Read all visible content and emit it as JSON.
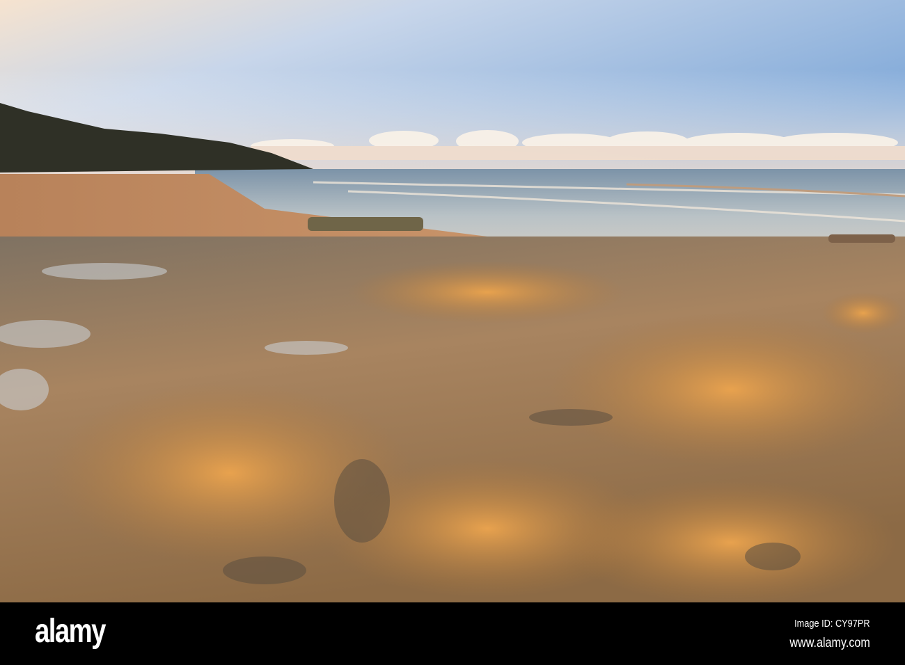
{
  "watermark": {
    "logo": "alamy",
    "image_id": "Image ID: CY97PR",
    "url": "www.alamy.com"
  },
  "colors": {
    "sky_top": "#8fb4de",
    "sky_warm": "#f3dcc6",
    "sea": "#8fa3b4",
    "sand": "#c48a5a",
    "rock_lit": "#d99a4a",
    "rock_shadow": "#6e6150",
    "headland": "#2f3026"
  }
}
